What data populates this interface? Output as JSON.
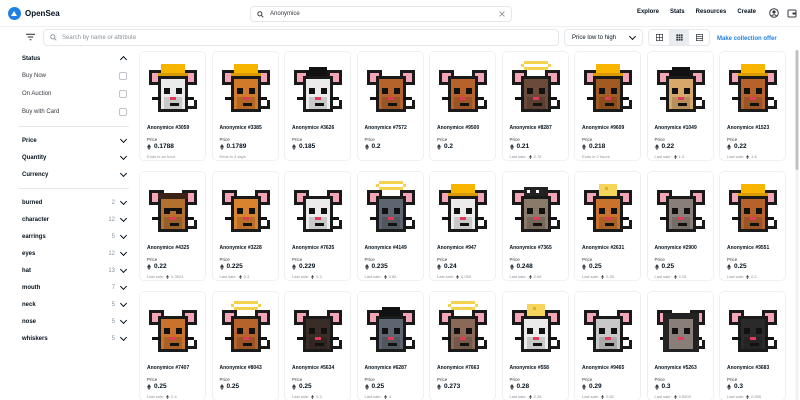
{
  "app": {
    "brand": "OpenSea",
    "search_value": "Anonymice"
  },
  "nav": {
    "links": [
      "Explore",
      "Stats",
      "Resources",
      "Create"
    ]
  },
  "toolbar": {
    "search_placeholder": "Search by name or attribute",
    "sort_label": "Price low to high",
    "collection_offer": "Make collection offer"
  },
  "sidebar": {
    "status_label": "Status",
    "status_options": [
      "Buy Now",
      "On Auction",
      "Buy with Card"
    ],
    "sections": [
      "Price",
      "Quantity",
      "Currency"
    ],
    "traits": [
      {
        "name": "burned",
        "count": "2"
      },
      {
        "name": "character",
        "count": "12"
      },
      {
        "name": "earrings",
        "count": "5"
      },
      {
        "name": "eyes",
        "count": "12"
      },
      {
        "name": "hat",
        "count": "13"
      },
      {
        "name": "mouth",
        "count": "7"
      },
      {
        "name": "neck",
        "count": "5"
      },
      {
        "name": "nose",
        "count": "5"
      },
      {
        "name": "whiskers",
        "count": "5"
      }
    ]
  },
  "price_label": "Price",
  "cards": [
    {
      "name": "Anonymice #3059",
      "price": "0.1788",
      "meta": "Ends in an hour",
      "fur": "#ebebeb",
      "hat": "hardhat"
    },
    {
      "name": "Anonymice #3385",
      "price": "0.1789",
      "meta": "Ends in 3 days",
      "fur": "#d07a2a",
      "hat": "hardhat"
    },
    {
      "name": "Anonymice #3626",
      "price": "0.185",
      "meta": "",
      "fur": "#ebebeb",
      "hat": "hair"
    },
    {
      "name": "Anonymice #7572",
      "price": "0.2",
      "meta": "",
      "fur": "#b5632b",
      "hat": "none"
    },
    {
      "name": "Anonymice #9500",
      "price": "0.2",
      "meta": "",
      "fur": "#b5632b",
      "hat": "none"
    },
    {
      "name": "Anonymice #8287",
      "price": "0.21",
      "meta_label": "Last sale:",
      "meta_value": "0.75",
      "fur": "#6b4a3a",
      "hat": "halo"
    },
    {
      "name": "Anonymice #9609",
      "price": "0.218",
      "meta": "Ends in 2 hours",
      "fur": "#a35a22",
      "hat": "hardhat"
    },
    {
      "name": "Anonymice #1049",
      "price": "0.22",
      "meta_label": "Last sale:",
      "meta_value": "1.4",
      "fur": "#d8a86a",
      "hat": "hair"
    },
    {
      "name": "Anonymice #1523",
      "price": "0.22",
      "meta_label": "Last sale:",
      "meta_value": "1.8",
      "fur": "#b5632b",
      "hat": "hardhat"
    },
    {
      "name": "Anonymice #4325",
      "price": "0.22",
      "meta_label": "Last sale:",
      "meta_value": "0.3924",
      "fur": "#b3702f",
      "hat": "pirate"
    },
    {
      "name": "Anonymice #3228",
      "price": "0.225",
      "meta_label": "Last sale:",
      "meta_value": "0.3",
      "fur": "#d8842f",
      "hat": "none"
    },
    {
      "name": "Anonymice #7635",
      "price": "0.229",
      "meta_label": "Last sale:",
      "meta_value": "0.3",
      "fur": "#ebebeb",
      "hat": "none"
    },
    {
      "name": "Anonymice #4149",
      "price": "0.235",
      "meta_label": "Last sale:",
      "meta_value": "0.85",
      "fur": "#5d6670",
      "hat": "halo"
    },
    {
      "name": "Anonymice #947",
      "price": "0.24",
      "meta_label": "Last sale:",
      "meta_value": "0.059",
      "fur": "#ebebeb",
      "hat": "hardhat"
    },
    {
      "name": "Anonymice #7365",
      "price": "0.248",
      "meta_label": "Last sale:",
      "meta_value": "0.65",
      "fur": "#8a7a6a",
      "hat": "cap"
    },
    {
      "name": "Anonymice #2631",
      "price": "0.25",
      "meta_label": "Last sale:",
      "meta_value": "0.35",
      "fur": "#c9722b",
      "hat": "cheese"
    },
    {
      "name": "Anonymice #2900",
      "price": "0.25",
      "meta_label": "Last sale:",
      "meta_value": "0.25",
      "fur": "#8a7f78",
      "hat": "none"
    },
    {
      "name": "Anonymice #9551",
      "price": "0.25",
      "meta_label": "Last sale:",
      "meta_value": "0.2",
      "fur": "#b5632b",
      "hat": "hardhat"
    },
    {
      "name": "Anonymice #7407",
      "price": "0.25",
      "meta_label": "Last sale:",
      "meta_value": "0.4",
      "fur": "#c9722b",
      "hat": "none"
    },
    {
      "name": "Anonymice #8043",
      "price": "0.25",
      "meta": "",
      "fur": "#b5632b",
      "hat": "halo"
    },
    {
      "name": "Anonymice #5634",
      "price": "0.25",
      "meta_label": "Last sale:",
      "meta_value": "0.3",
      "fur": "#3a2d28",
      "hat": "none"
    },
    {
      "name": "Anonymice #6287",
      "price": "0.25",
      "meta_label": "Last sale:",
      "meta_value": "4",
      "fur": "#5d6670",
      "hat": "hair"
    },
    {
      "name": "Anonymice #7663",
      "price": "0.273",
      "meta": "",
      "fur": "#8a6a56",
      "hat": "halo"
    },
    {
      "name": "Anonymice #558",
      "price": "0.28",
      "meta_label": "Last sale:",
      "meta_value": "0.28",
      "fur": "#ebebeb",
      "hat": "cheese"
    },
    {
      "name": "Anonymice #9465",
      "price": "0.29",
      "meta_label": "Last sale:",
      "meta_value": "0.82",
      "fur": "#c8c8c8",
      "hat": "none"
    },
    {
      "name": "Anonymice #5263",
      "price": "0.3",
      "meta_label": "Last sale:",
      "meta_value": "0.5909",
      "fur": "#8a7f78",
      "hat": "hood"
    },
    {
      "name": "Anonymice #3683",
      "price": "0.3",
      "meta_label": "Last sale:",
      "meta_value": "0.595",
      "fur": "#2a2a2a",
      "hat": "none"
    }
  ],
  "colors": {
    "accent": "#2081e2",
    "border": "#e5e8eb",
    "text": "#04111d",
    "muted": "#8a939b"
  }
}
